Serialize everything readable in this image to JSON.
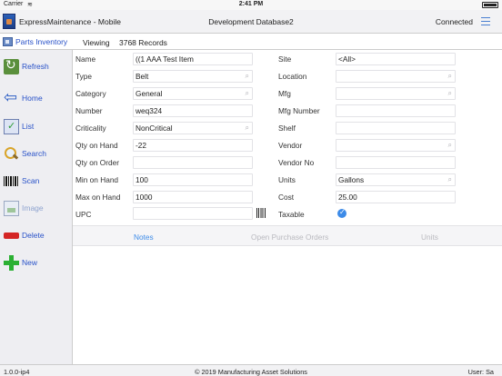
{
  "status_bar": {
    "carrier": "Carrier",
    "time": "2:41 PM"
  },
  "header": {
    "app_title": "ExpressMaintenance - Mobile",
    "database": "Development Database2",
    "connection": "Connected"
  },
  "subheader": {
    "module": "Parts Inventory",
    "viewing_label": "Viewing",
    "record_count": "3768 Records"
  },
  "sidebar": {
    "refresh": "Refresh",
    "home": "Home",
    "list": "List",
    "search": "Search",
    "scan": "Scan",
    "image": "Image",
    "delete": "Delete",
    "new": "New"
  },
  "form": {
    "name_label": "Name",
    "name_value": "((1 AAA Test Item",
    "type_label": "Type",
    "type_value": "Belt",
    "category_label": "Category",
    "category_value": "General",
    "number_label": "Number",
    "number_value": "weq324",
    "criticality_label": "Criticality",
    "criticality_value": "NonCritical",
    "qty_on_hand_label": "Qty on Hand",
    "qty_on_hand_value": "-22",
    "qty_on_order_label": "Qty on Order",
    "qty_on_order_value": "",
    "min_on_hand_label": "Min on Hand",
    "min_on_hand_value": "100",
    "max_on_hand_label": "Max on Hand",
    "max_on_hand_value": "1000",
    "upc_label": "UPC",
    "upc_value": "",
    "site_label": "Site",
    "site_value": "<All>",
    "location_label": "Location",
    "location_value": "",
    "mfg_label": "Mfg",
    "mfg_value": "",
    "mfg_number_label": "Mfg Number",
    "mfg_number_value": "",
    "shelf_label": "Shelf",
    "shelf_value": "",
    "vendor_label": "Vendor",
    "vendor_value": "",
    "vendor_no_label": "Vendor No",
    "vendor_no_value": "",
    "units_label": "Units",
    "units_value": "Gallons",
    "cost_label": "Cost",
    "cost_value": "25.00",
    "taxable_label": "Taxable",
    "taxable_checked": true
  },
  "tabs": {
    "notes": "Notes",
    "open_po": "Open Purchase Orders",
    "units": "Units"
  },
  "footer": {
    "version": "1.0.0-ip4",
    "copyright": "© 2019 Manufacturing Asset Solutions",
    "user": "User: Sa"
  },
  "colors": {
    "accent": "#3d8be8",
    "link": "#2851c8",
    "delete_red": "#d42525",
    "new_green": "#2bb033"
  }
}
